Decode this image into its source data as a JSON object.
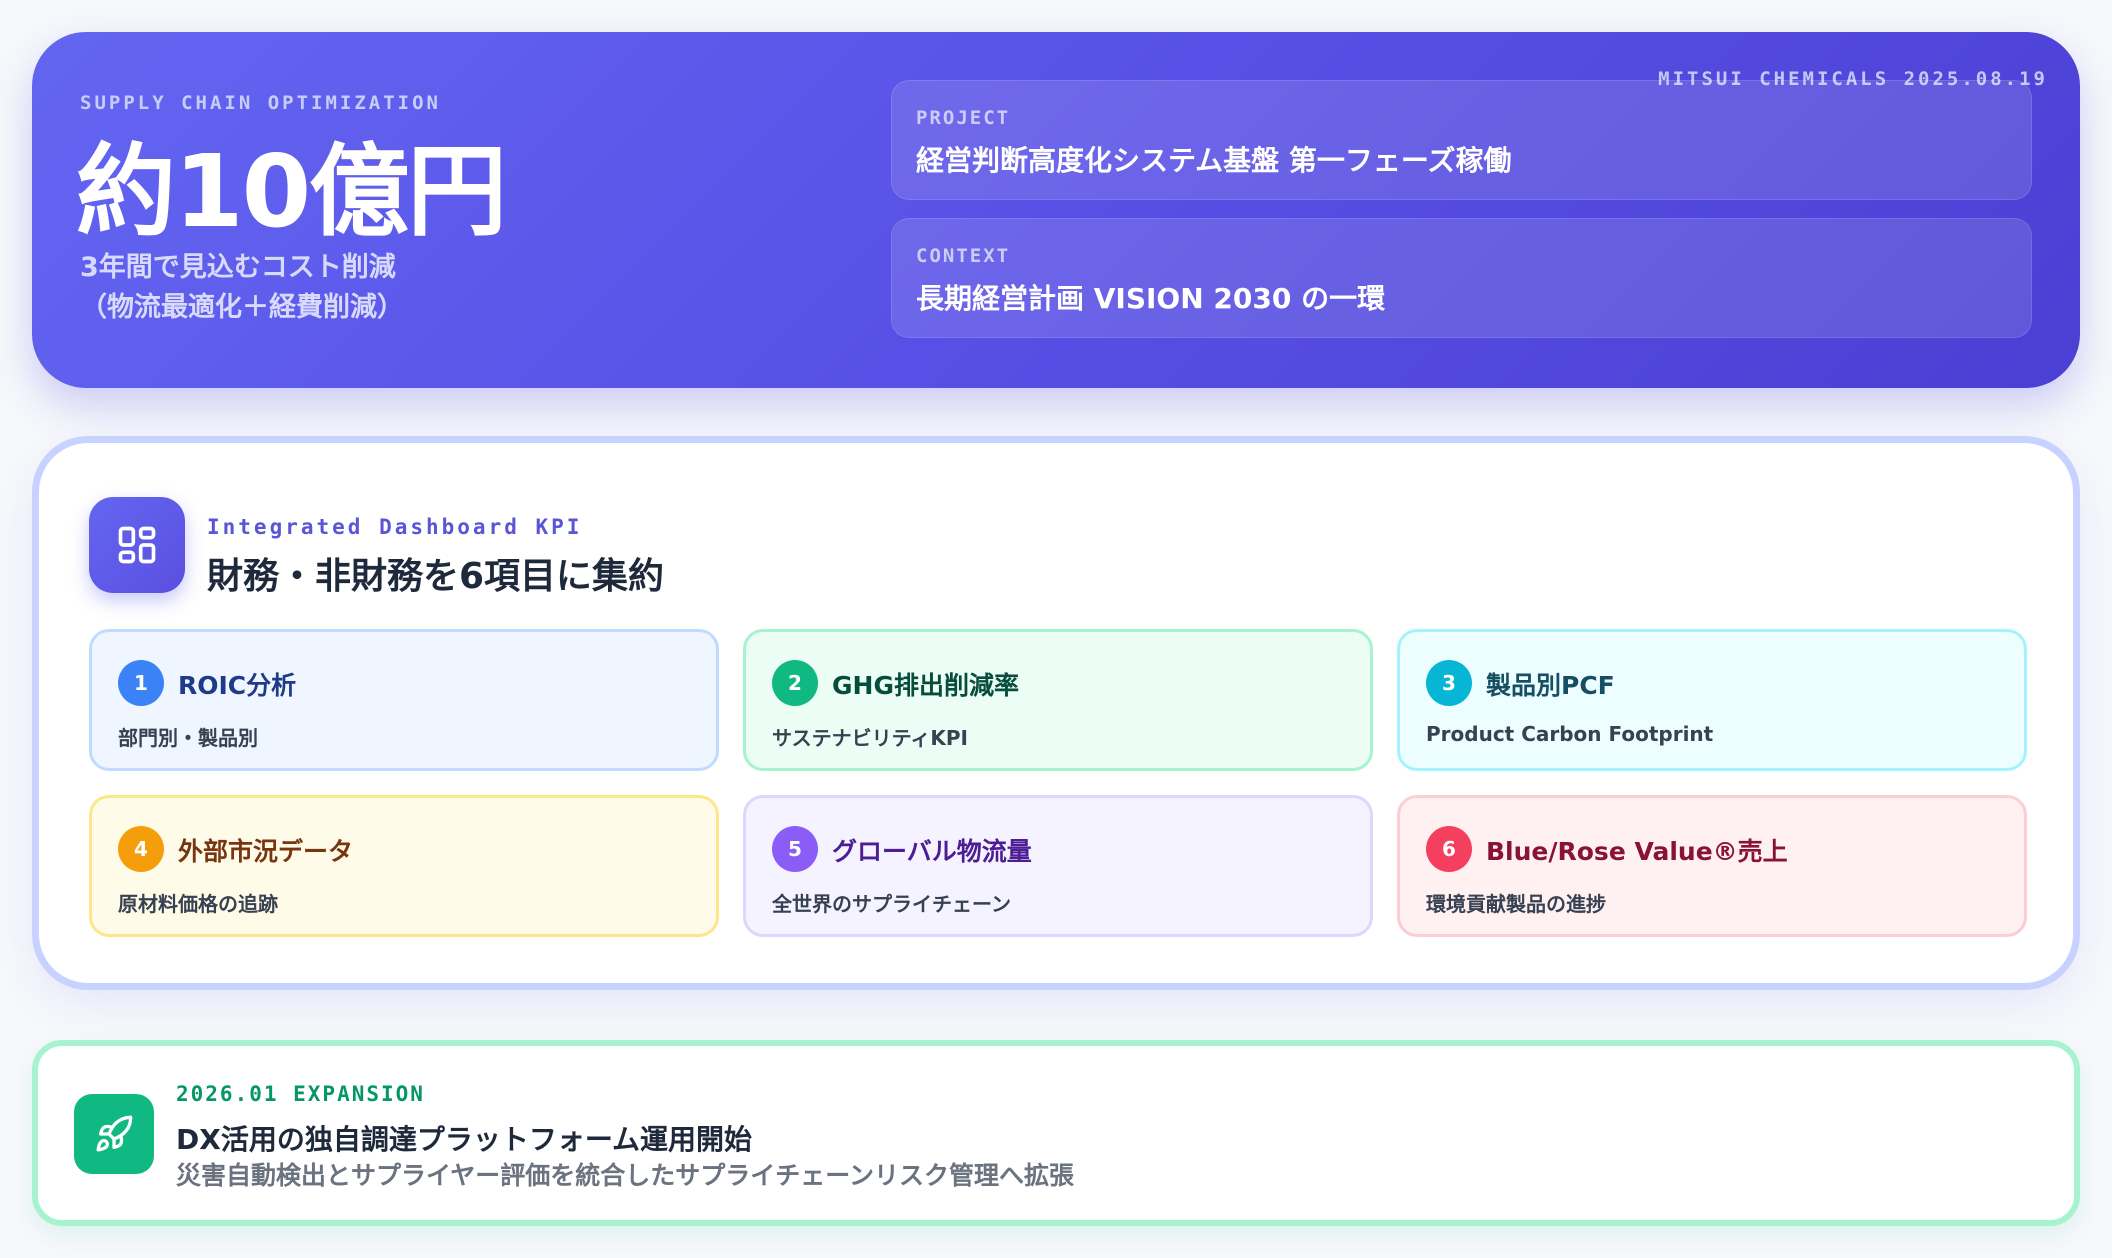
{
  "hero": {
    "tag": "SUPPLY CHAIN OPTIMIZATION",
    "stamp": "MITSUI CHEMICALS 2025.08.19",
    "headline": "約10億円",
    "sub_line1": "3年間で見込むコスト削減",
    "sub_line2": "（物流最適化＋経費削減）",
    "project_label": "PROJECT",
    "project_value": "経営判断高度化システム基盤 第一フェーズ稼働",
    "context_label": "CONTEXT",
    "context_value": "長期経営計画 VISION 2030 の一環"
  },
  "kpi": {
    "icon": "dashboard-grid-icon",
    "eyebrow": "Integrated Dashboard KPI",
    "title": "財務・非財務を6項目に集約",
    "items": [
      {
        "num": "1",
        "title": "ROIC分析",
        "desc": "部門別・製品別",
        "color": "#3b82f6"
      },
      {
        "num": "2",
        "title": "GHG排出削減率",
        "desc": "サステナビリティKPI",
        "color": "#10b981"
      },
      {
        "num": "3",
        "title": "製品別PCF",
        "desc": "Product Carbon Footprint",
        "color": "#06b6d4"
      },
      {
        "num": "4",
        "title": "外部市況データ",
        "desc": "原材料価格の追跡",
        "color": "#f59e0b"
      },
      {
        "num": "5",
        "title": "グローバル物流量",
        "desc": "全世界のサプライチェーン",
        "color": "#8b5cf6"
      },
      {
        "num": "6",
        "title": "Blue/Rose Value®売上",
        "desc": "環境貢献製品の進捗",
        "color": "#f43f5e"
      }
    ]
  },
  "expansion": {
    "icon": "rocket-icon",
    "eyebrow": "2026.01 EXPANSION",
    "title": "DX活用の独自調達プラットフォーム運用開始",
    "desc": "災害自動検出とサプライヤー評価を統合したサプライチェーンリスク管理へ拡張"
  }
}
